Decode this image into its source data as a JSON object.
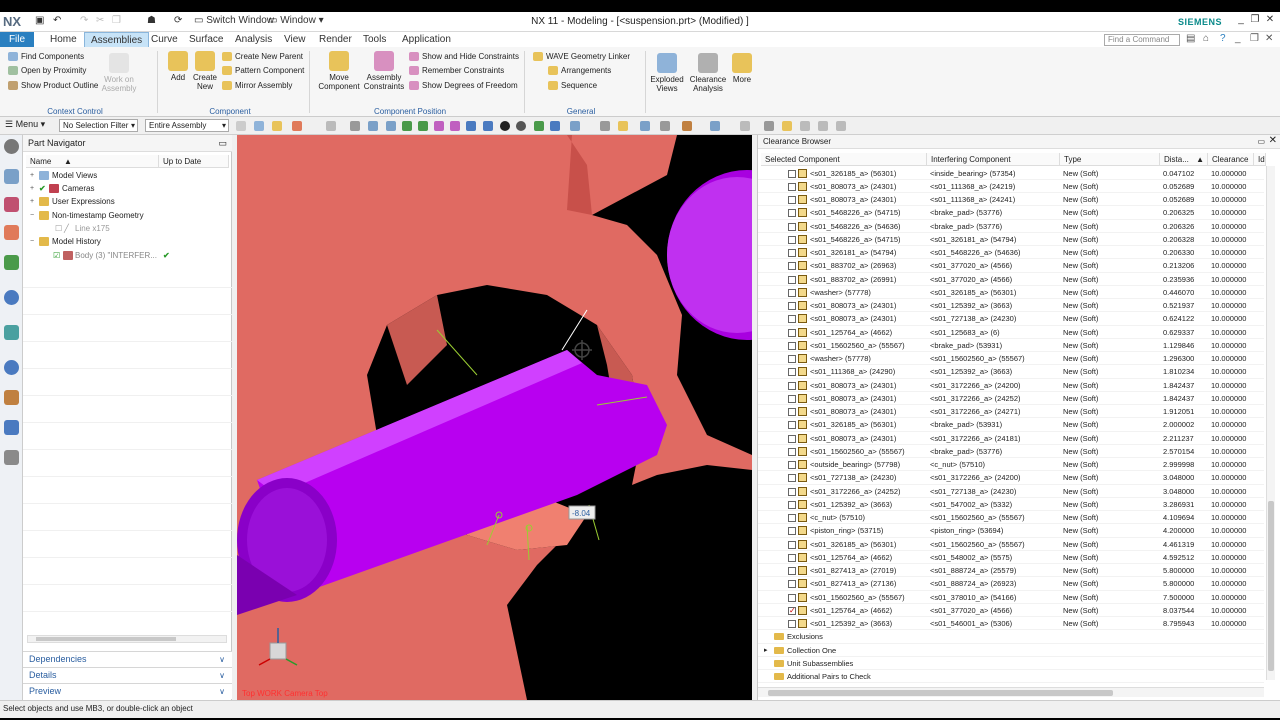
{
  "app": {
    "logo": "NX",
    "window_title": "NX 11 - Modeling - [<suspension.prt> (Modified) ]",
    "brand": "SIEMENS"
  },
  "quick_access": {
    "switch_window": "Switch Window",
    "window": "Window"
  },
  "tabs": [
    "File",
    "Home",
    "Assemblies",
    "Curve",
    "Surface",
    "Analysis",
    "View",
    "Render",
    "Tools",
    "Application"
  ],
  "active_tab": "Assemblies",
  "find_command_placeholder": "Find a Command",
  "ribbon": {
    "context_control": {
      "items": [
        "Find Components",
        "Open by Proximity",
        "Show Product Outline"
      ],
      "work_on": "Work on Assembly",
      "label": "Context Control"
    },
    "component": {
      "add": "Add",
      "create_new": "Create New",
      "items": [
        "Create New Parent",
        "Pattern Component",
        "Mirror Assembly"
      ],
      "label": "Component"
    },
    "component_position": {
      "move": "Move Component",
      "constraints": "Assembly Constraints",
      "items": [
        "Show and Hide Constraints",
        "Remember Constraints",
        "Show Degrees of Freedom"
      ],
      "label": "Component Position"
    },
    "general": {
      "items": [
        "WAVE Geometry Linker",
        "Arrangements",
        "Sequence"
      ],
      "label": "General"
    },
    "exploded_views": "Exploded Views",
    "clearance_analysis": "Clearance Analysis",
    "more": "More"
  },
  "toolbar": {
    "menu": "Menu",
    "selection_filter": "No Selection Filter",
    "scope": "Entire Assembly"
  },
  "part_navigator": {
    "title": "Part Navigator",
    "col_name": "Name",
    "col_uptodate": "Up to Date",
    "rows": [
      {
        "label": "Model Views"
      },
      {
        "label": "Cameras"
      },
      {
        "label": "User Expressions"
      },
      {
        "label": "Non-timestamp Geometry"
      },
      {
        "label": "Line x175"
      },
      {
        "label": "Model History"
      },
      {
        "label": "Body (3) \"INTERFER..."
      }
    ],
    "panels": [
      "Dependencies",
      "Details",
      "Preview"
    ]
  },
  "viewport": {
    "label": "Top WORK Camera Top",
    "dim_value": "-8.04"
  },
  "clearance_browser": {
    "title": "Clearance Browser",
    "columns": [
      "Selected Component",
      "Interfering Component",
      "Type",
      "Dista...",
      "Clearance",
      "Ide"
    ],
    "rows": [
      [
        "<s01_326185_a> (56301)",
        "<inside_bearing> (57354)",
        "New (Soft)",
        "0.047102",
        "10.000000"
      ],
      [
        "<s01_808073_a> (24301)",
        "<s01_111368_a> (24219)",
        "New (Soft)",
        "0.052689",
        "10.000000"
      ],
      [
        "<s01_808073_a> (24301)",
        "<s01_111368_a> (24241)",
        "New (Soft)",
        "0.052689",
        "10.000000"
      ],
      [
        "<s01_5468226_a> (54715)",
        "<brake_pad> (53776)",
        "New (Soft)",
        "0.206325",
        "10.000000"
      ],
      [
        "<s01_5468226_a> (54636)",
        "<brake_pad> (53776)",
        "New (Soft)",
        "0.206326",
        "10.000000"
      ],
      [
        "<s01_5468226_a> (54715)",
        "<s01_326181_a> (54794)",
        "New (Soft)",
        "0.206328",
        "10.000000"
      ],
      [
        "<s01_326181_a> (54794)",
        "<s01_5468226_a> (54636)",
        "New (Soft)",
        "0.206330",
        "10.000000"
      ],
      [
        "<s01_883702_a> (26963)",
        "<s01_377020_a> (4566)",
        "New (Soft)",
        "0.213206",
        "10.000000"
      ],
      [
        "<s01_883702_a> (26991)",
        "<s01_377020_a> (4566)",
        "New (Soft)",
        "0.235936",
        "10.000000"
      ],
      [
        "<washer> (57778)",
        "<s01_326185_a> (56301)",
        "New (Soft)",
        "0.446070",
        "10.000000"
      ],
      [
        "<s01_808073_a> (24301)",
        "<s01_125392_a> (3663)",
        "New (Soft)",
        "0.521937",
        "10.000000"
      ],
      [
        "<s01_808073_a> (24301)",
        "<s01_727138_a> (24230)",
        "New (Soft)",
        "0.624122",
        "10.000000"
      ],
      [
        "<s01_125764_a> (4662)",
        "<s01_125683_a> (6)",
        "New (Soft)",
        "0.629337",
        "10.000000"
      ],
      [
        "<s01_15602560_a> (55567)",
        "<brake_pad> (53931)",
        "New (Soft)",
        "1.129846",
        "10.000000"
      ],
      [
        "<washer> (57778)",
        "<s01_15602560_a> (55567)",
        "New (Soft)",
        "1.296300",
        "10.000000"
      ],
      [
        "<s01_111368_a> (24290)",
        "<s01_125392_a> (3663)",
        "New (Soft)",
        "1.810234",
        "10.000000"
      ],
      [
        "<s01_808073_a> (24301)",
        "<s01_3172266_a> (24200)",
        "New (Soft)",
        "1.842437",
        "10.000000"
      ],
      [
        "<s01_808073_a> (24301)",
        "<s01_3172266_a> (24252)",
        "New (Soft)",
        "1.842437",
        "10.000000"
      ],
      [
        "<s01_808073_a> (24301)",
        "<s01_3172266_a> (24271)",
        "New (Soft)",
        "1.912051",
        "10.000000"
      ],
      [
        "<s01_326185_a> (56301)",
        "<brake_pad> (53931)",
        "New (Soft)",
        "2.000002",
        "10.000000"
      ],
      [
        "<s01_808073_a> (24301)",
        "<s01_3172266_a> (24181)",
        "New (Soft)",
        "2.211237",
        "10.000000"
      ],
      [
        "<s01_15602560_a> (55567)",
        "<brake_pad> (53776)",
        "New (Soft)",
        "2.570154",
        "10.000000"
      ],
      [
        "<outside_bearing> (57798)",
        "<c_nut> (57510)",
        "New (Soft)",
        "2.999998",
        "10.000000"
      ],
      [
        "<s01_727138_a> (24230)",
        "<s01_3172266_a> (24200)",
        "New (Soft)",
        "3.048000",
        "10.000000"
      ],
      [
        "<s01_3172266_a> (24252)",
        "<s01_727138_a> (24230)",
        "New (Soft)",
        "3.048000",
        "10.000000"
      ],
      [
        "<s01_125392_a> (3663)",
        "<s01_547002_a> (5332)",
        "New (Soft)",
        "3.286931",
        "10.000000"
      ],
      [
        "<c_nut> (57510)",
        "<s01_15602560_a> (55567)",
        "New (Soft)",
        "4.109694",
        "10.000000"
      ],
      [
        "<piston_ring> (53715)",
        "<piston_ring> (53694)",
        "New (Soft)",
        "4.200000",
        "10.000000"
      ],
      [
        "<s01_326185_a> (56301)",
        "<s01_15602560_a> (55567)",
        "New (Soft)",
        "4.461319",
        "10.000000"
      ],
      [
        "<s01_125764_a> (4662)",
        "<s01_548002_a> (5575)",
        "New (Soft)",
        "4.592512",
        "10.000000"
      ],
      [
        "<s01_827413_a> (27019)",
        "<s01_888724_a> (25579)",
        "New (Soft)",
        "5.800000",
        "10.000000"
      ],
      [
        "<s01_827413_a> (27136)",
        "<s01_888724_a> (26923)",
        "New (Soft)",
        "5.800000",
        "10.000000"
      ],
      [
        "<s01_15602560_a> (55567)",
        "<s01_378010_a> (54166)",
        "New (Soft)",
        "7.500000",
        "10.000000"
      ],
      [
        "<s01_125764_a> (4662)",
        "<s01_377020_a> (4566)",
        "New (Soft)",
        "8.037544",
        "10.000000"
      ],
      [
        "<s01_125392_a> (3663)",
        "<s01_546001_a> (5306)",
        "New (Soft)",
        "8.795943",
        "10.000000"
      ]
    ],
    "checked_row": 33,
    "folders": [
      "Exclusions",
      "Collection One",
      "Unit Subassemblies",
      "Additional Pairs to Check"
    ]
  },
  "status": "Select objects and use MB3, or double-click an object",
  "colors": {
    "accent": "#2a7fc0",
    "part_salmon": "#e06a62",
    "shaft_magenta": "#b000e8"
  }
}
